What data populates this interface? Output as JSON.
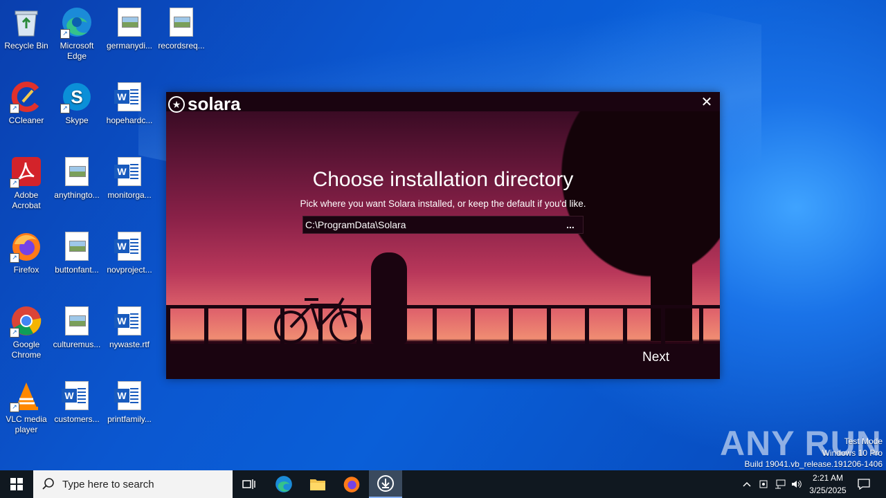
{
  "desktop": {
    "icons": [
      {
        "label": "Recycle Bin",
        "icon": "recycle-bin-icon"
      },
      {
        "label": "Microsoft Edge",
        "icon": "edge-icon"
      },
      {
        "label": "germanydi...",
        "icon": "image-file-icon"
      },
      {
        "label": "recordsreq...",
        "icon": "image-file-icon"
      },
      {
        "label": "CCleaner",
        "icon": "ccleaner-icon"
      },
      {
        "label": "Skype",
        "icon": "skype-icon"
      },
      {
        "label": "hopehardc...",
        "icon": "word-doc-icon"
      },
      {
        "label": "Adobe Acrobat",
        "icon": "acrobat-icon"
      },
      {
        "label": "anythingto...",
        "icon": "image-file-icon"
      },
      {
        "label": "monitorga...",
        "icon": "word-doc-icon"
      },
      {
        "label": "Firefox",
        "icon": "firefox-icon"
      },
      {
        "label": "buttonfant...",
        "icon": "image-file-icon"
      },
      {
        "label": "novproject...",
        "icon": "word-doc-icon"
      },
      {
        "label": "Google Chrome",
        "icon": "chrome-icon"
      },
      {
        "label": "culturemus...",
        "icon": "image-file-icon"
      },
      {
        "label": "nywaste.rtf",
        "icon": "word-doc-icon"
      },
      {
        "label": "VLC media player",
        "icon": "vlc-icon"
      },
      {
        "label": "customers...",
        "icon": "word-doc-icon"
      },
      {
        "label": "printfamily...",
        "icon": "word-doc-icon"
      }
    ]
  },
  "installer": {
    "brand": "solara",
    "heading": "Choose installation directory",
    "subtitle": "Pick where you want Solara installed, or keep the default if you'd like.",
    "path_value": "C:\\ProgramData\\Solara",
    "browse_label": "...",
    "next_label": "Next",
    "close_label": "✕"
  },
  "watermark": {
    "text": "ANY RUN",
    "mode": "Test Mode",
    "edition": "Windows 10 Pro",
    "build": "Build 19041.vb_release.191206-1406"
  },
  "taskbar": {
    "search_placeholder": "Type here to search",
    "time": "2:21 AM",
    "date": "3/25/2025"
  }
}
